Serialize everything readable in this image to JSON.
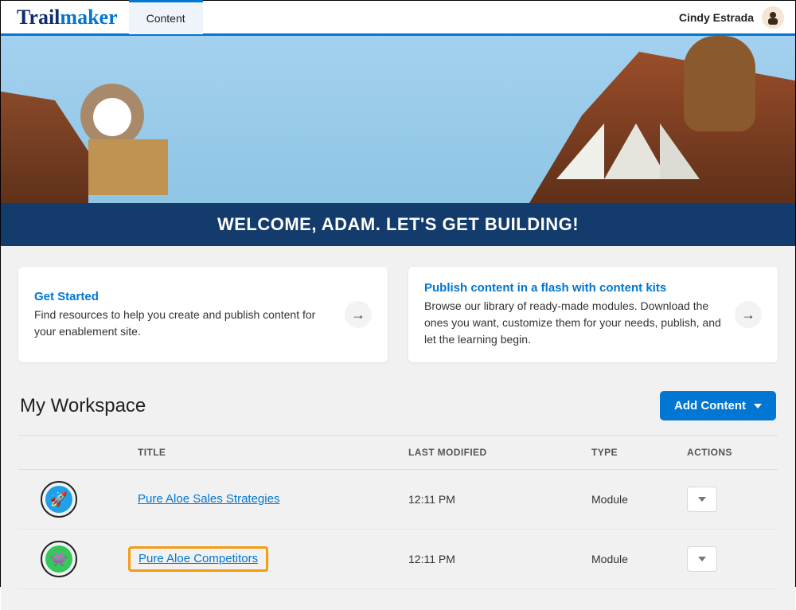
{
  "header": {
    "logo_a": "Trail",
    "logo_b": "maker",
    "tab": "Content",
    "username": "Cindy Estrada"
  },
  "banner": "WELCOME, ADAM. LET'S GET BUILDING!",
  "cards": {
    "get_started": {
      "title": "Get Started",
      "desc": "Find resources to help you create and publish content for your enablement site."
    },
    "content_kits": {
      "title": "Publish content in a flash with content kits",
      "desc": "Browse our library of ready-made modules. Download the ones you want, customize them for your needs, publish, and let the learning begin."
    }
  },
  "workspace": {
    "title": "My Workspace",
    "add_button": "Add Content",
    "columns": {
      "title": "TITLE",
      "modified": "LAST MODIFIED",
      "type": "TYPE",
      "actions": "ACTIONS"
    },
    "rows": [
      {
        "title": "Pure Aloe Sales Strategies",
        "modified": "12:11 PM",
        "type": "Module",
        "icon_bg": "#1fa0e8",
        "icon_glyph": "🚀",
        "highlighted": false
      },
      {
        "title": "Pure Aloe Competitors",
        "modified": "12:11 PM",
        "type": "Module",
        "icon_bg": "#34c759",
        "icon_glyph": "👾",
        "highlighted": true
      }
    ]
  }
}
